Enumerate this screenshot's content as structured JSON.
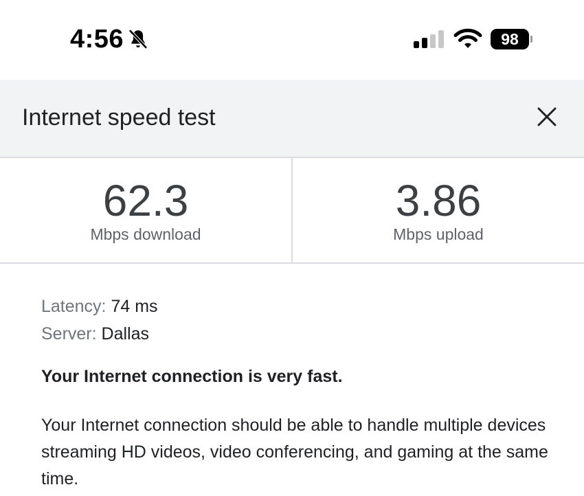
{
  "status_bar": {
    "time": "4:56",
    "battery_percent": "98",
    "icons": [
      "bell-slash-icon",
      "cellular-signal-icon",
      "wifi-icon",
      "battery-icon"
    ]
  },
  "header": {
    "title": "Internet speed test",
    "close_icon": "close-icon"
  },
  "results": {
    "download": {
      "value": "62.3",
      "label": "Mbps download"
    },
    "upload": {
      "value": "3.86",
      "label": "Mbps upload"
    }
  },
  "details": {
    "latency_label": "Latency:",
    "latency_value": "74 ms",
    "server_label": "Server:",
    "server_value": "Dallas"
  },
  "verdict": "Your Internet connection is very fast.",
  "description": "Your Internet connection should be able to handle multiple devices streaming HD videos, video conferencing, and gaming at the same time.",
  "colors": {
    "header_bg": "#f1f3f4",
    "divider": "#dadce0",
    "text_primary": "#202124",
    "text_secondary": "#70757a"
  }
}
